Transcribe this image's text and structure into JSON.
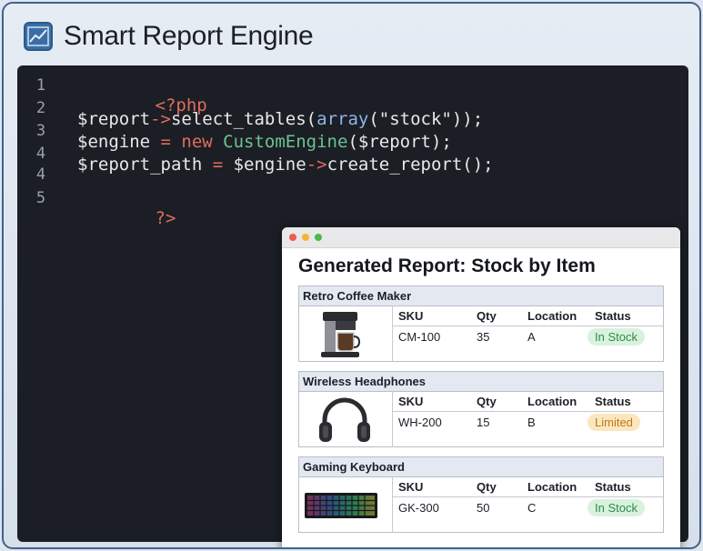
{
  "header": {
    "title": "Smart Report Engine",
    "icon": "chart-line-icon"
  },
  "editor": {
    "line_numbers": [
      "1",
      "2",
      "3",
      "4",
      "4",
      "5"
    ],
    "code": {
      "open_tag": "<?php",
      "line2_var": "$report",
      "line2_arrow": "->",
      "line2_fn": "select_tables(",
      "line2_arr": "array",
      "line2_rest": "(\"stock\"));",
      "line3_var": "$engine",
      "line3_eq": " = ",
      "line3_new": "new ",
      "line3_cls": "CustomEngine",
      "line3_rest": "($report);",
      "line4_var": "$report_path",
      "line4_eq": " = ",
      "line4_var2": "$engine",
      "line4_arrow": "->",
      "line4_rest": "create_report();",
      "close_tag": "?>"
    }
  },
  "report": {
    "title": "Generated Report: Stock by Item",
    "columns": {
      "sku": "SKU",
      "qty": "Qty",
      "location": "Location",
      "status": "Status"
    },
    "items": [
      {
        "name": "Retro Coffee Maker",
        "sku": "CM-100",
        "qty": "35",
        "location": "A",
        "status": "In Stock",
        "image": "coffee-maker-icon"
      },
      {
        "name": "Wireless Headphones",
        "sku": "WH-200",
        "qty": "15",
        "location": "B",
        "status": "Limited",
        "image": "headphones-icon"
      },
      {
        "name": "Gaming Keyboard",
        "sku": "GK-300",
        "qty": "50",
        "location": "C",
        "status": "In Stock",
        "image": "keyboard-icon"
      }
    ]
  },
  "colors": {
    "in_stock_bg": "#d9f2dd",
    "in_stock_fg": "#2e8b4a",
    "limited_bg": "#fbe7bf",
    "limited_fg": "#c07a12",
    "dot_red": "#ee5b52",
    "dot_yellow": "#f4b632",
    "dot_green": "#4cb84c"
  }
}
